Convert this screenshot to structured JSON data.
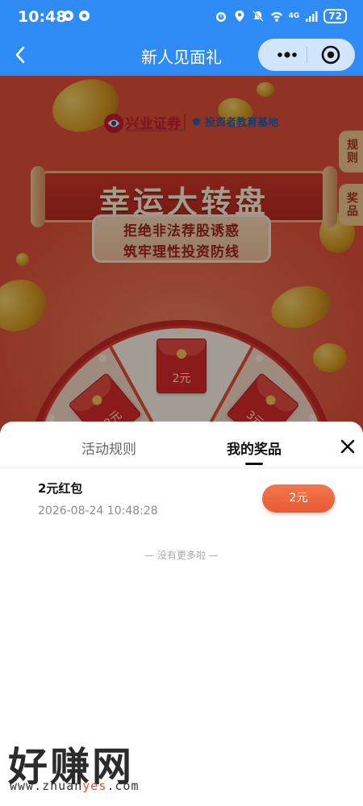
{
  "status_bar": {
    "time": "10:48",
    "network": "4G",
    "battery": "72"
  },
  "nav": {
    "title": "新人见面礼"
  },
  "hero": {
    "brand_name": "兴业证券",
    "partner_name": "投资者教育基地",
    "title": "幸运大转盘",
    "slogan_line1": "拒绝非法荐股诱惑",
    "slogan_line2": "筑牢理性投资防线",
    "side_tab_rules": "规则",
    "side_tab_prizes": "奖品",
    "wheel_prizes": [
      "2元",
      "2元",
      "3元"
    ]
  },
  "sheet": {
    "tabs": [
      {
        "label": "活动规则",
        "active": false
      },
      {
        "label": "我的奖品",
        "active": true
      }
    ],
    "prizes": [
      {
        "name": "2元红包",
        "time": "2026-08-24 10:48:28",
        "amount": "2元"
      }
    ],
    "footer_text": "— 没有更多啦 —"
  },
  "watermark": {
    "text": "好赚网",
    "url_prefix": "www.zhuan",
    "url_accent": "yes",
    "url_suffix": ".com"
  },
  "colors": {
    "nav_blue": "#2f8cf6",
    "hero_red": "#e2513a",
    "badge_orange": "#e85a34"
  }
}
